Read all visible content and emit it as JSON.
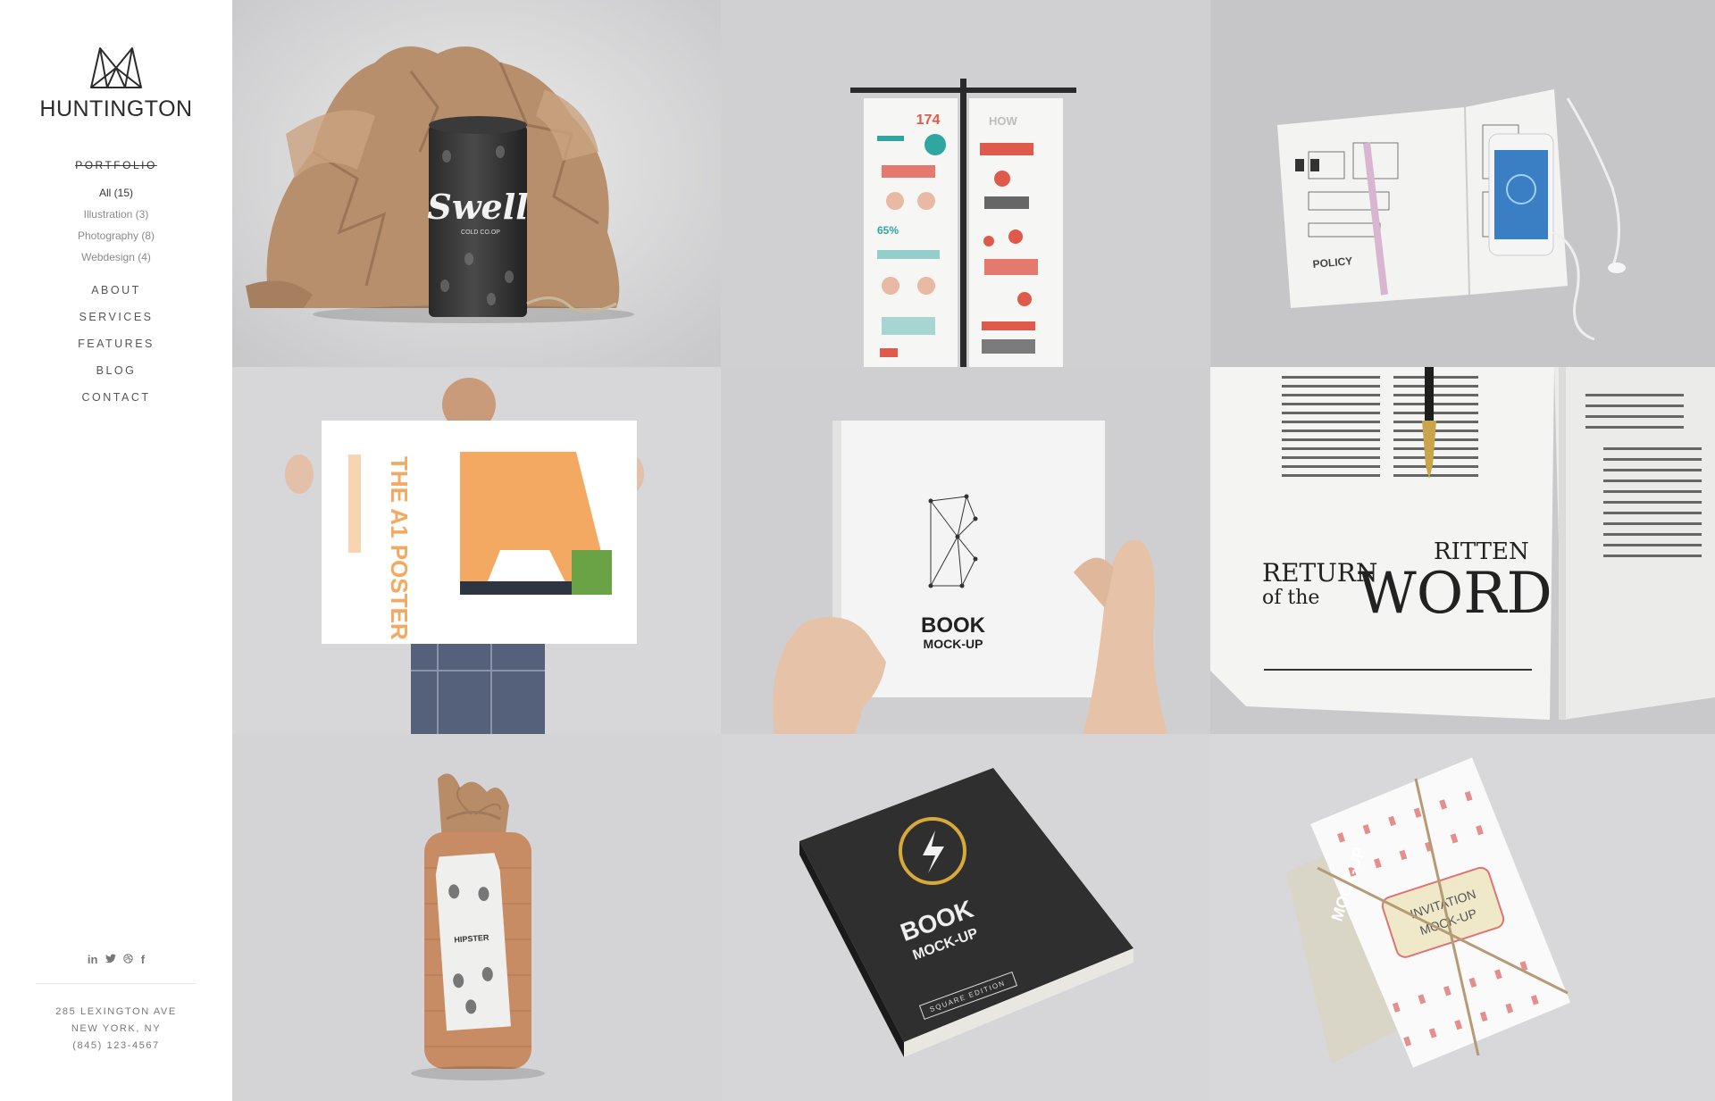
{
  "brand": {
    "name": "HUNTINGTON",
    "logo_icon": "mountain-outline-logo"
  },
  "nav": {
    "portfolio": "PORTFOLIO",
    "filters": [
      "All (15)",
      "Illustration (3)",
      "Photography (8)",
      "Webdesign (4)"
    ],
    "active_filter": "All (15)",
    "items": [
      "ABOUT",
      "SERVICES",
      "FEATURES",
      "BLOG",
      "CONTACT"
    ]
  },
  "social": {
    "linkedin": "in",
    "twitter_icon": "twitter-icon",
    "dribbble_icon": "dribbble-icon",
    "facebook": "f"
  },
  "address": {
    "line1": "285 LEXINGTON AVE",
    "line2": "NEW YORK, NY",
    "phone": "(845) 123-4567"
  },
  "portfolio": {
    "tiles": [
      {
        "name": "coffee-can-mockup",
        "can_label": "Swell",
        "can_sub": "COLD CO.OP"
      },
      {
        "name": "infographic-banners",
        "number": "174",
        "how": "HOW"
      },
      {
        "name": "sketchbook-iphone",
        "sketch_text": "POLICY"
      },
      {
        "name": "a1-poster",
        "poster_title": "THE A1 POSTER",
        "big_letter": "A"
      },
      {
        "name": "book-mockup-white",
        "book_letter": "B",
        "book_title": "BOOK",
        "book_sub": "MOCK-UP"
      },
      {
        "name": "magazine-spread",
        "headline_1": "RETURN",
        "headline_2": "of the",
        "headline_3": "RITTEN",
        "headline_4": "WORD"
      },
      {
        "name": "paper-bag-bottle",
        "tag_text": "HIPSTER"
      },
      {
        "name": "book-mockup-black",
        "book_title": "BOOK",
        "book_sub": "MOCK-UP",
        "edition": "SQUARE EDITION"
      },
      {
        "name": "invitation-mockup",
        "invite_1": "INVITATION",
        "invite_2": "MOCK-UP",
        "side_text": "MOCK-UP"
      }
    ]
  },
  "colors": {
    "accent_orange": "#f4a963",
    "accent_green": "#6aa346",
    "navy": "#2e3442"
  }
}
